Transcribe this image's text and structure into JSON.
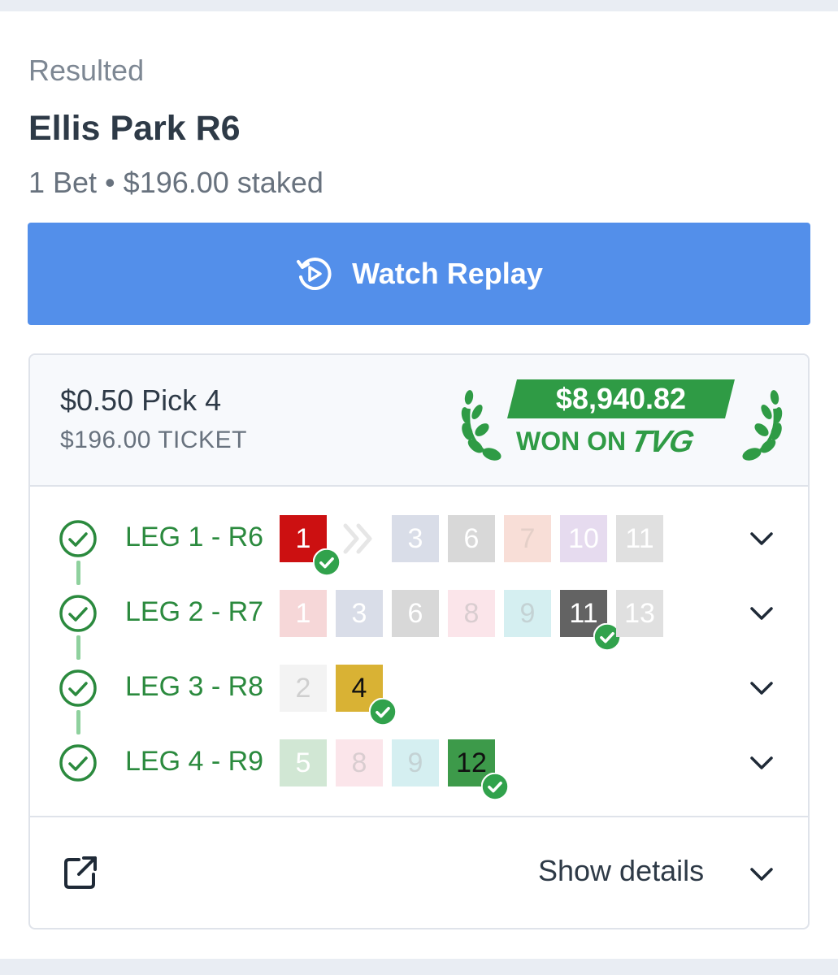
{
  "event": {
    "status": "Resulted",
    "title": "Ellis Park R6",
    "summary": "1 Bet • $196.00 staked"
  },
  "replay_button": {
    "label": "Watch Replay",
    "icon": "replay-icon"
  },
  "bet": {
    "type": "$0.50 Pick 4",
    "ticket": "$196.00 TICKET",
    "win_amount": "$8,940.82",
    "won_on": "WON ON",
    "brand": "TVG",
    "legs": [
      {
        "label": "LEG 1 - R6",
        "status": "won",
        "runners": [
          {
            "number": "1",
            "winner": true,
            "bg": "#cc1011",
            "fg": "#ffffff"
          },
          {
            "number": "3",
            "winner": false,
            "bg": "#d9dde8",
            "fg": "#ffffff"
          },
          {
            "number": "6",
            "winner": false,
            "bg": "#d8d8d8",
            "fg": "#ffffff"
          },
          {
            "number": "7",
            "winner": false,
            "bg": "#f8ded7",
            "fg": "#e4cfc8"
          },
          {
            "number": "10",
            "winner": false,
            "bg": "#e6dbef",
            "fg": "#ffffff"
          },
          {
            "number": "11",
            "winner": false,
            "bg": "#e0e0e0",
            "fg": "#ffffff"
          }
        ]
      },
      {
        "label": "LEG 2 - R7",
        "status": "won",
        "runners": [
          {
            "number": "1",
            "winner": false,
            "bg": "#f6d7d8",
            "fg": "#ffffff"
          },
          {
            "number": "3",
            "winner": false,
            "bg": "#d9dde8",
            "fg": "#ffffff"
          },
          {
            "number": "6",
            "winner": false,
            "bg": "#d8d8d8",
            "fg": "#ffffff"
          },
          {
            "number": "8",
            "winner": false,
            "bg": "#fbe5ea",
            "fg": "#d9cdd0"
          },
          {
            "number": "9",
            "winner": false,
            "bg": "#d5eff1",
            "fg": "#c4d2d4"
          },
          {
            "number": "11",
            "winner": true,
            "bg": "#636363",
            "fg": "#ffffff"
          },
          {
            "number": "13",
            "winner": false,
            "bg": "#e0e0e0",
            "fg": "#ffffff"
          }
        ]
      },
      {
        "label": "LEG 3 - R8",
        "status": "won",
        "runners": [
          {
            "number": "2",
            "winner": false,
            "bg": "#f3f3f3",
            "fg": "#cfcfcf"
          },
          {
            "number": "4",
            "winner": true,
            "bg": "#d9b234",
            "fg": "#111111"
          }
        ]
      },
      {
        "label": "LEG 4 - R9",
        "status": "won",
        "runners": [
          {
            "number": "5",
            "winner": false,
            "bg": "#d1e7d4",
            "fg": "#ffffff"
          },
          {
            "number": "8",
            "winner": false,
            "bg": "#fbe5ea",
            "fg": "#d9cdd0"
          },
          {
            "number": "9",
            "winner": false,
            "bg": "#d5eff1",
            "fg": "#c4d2d4"
          },
          {
            "number": "12",
            "winner": true,
            "bg": "#3d9a4a",
            "fg": "#111111"
          }
        ]
      }
    ]
  },
  "footer": {
    "show_details": "Show details",
    "external_icon": "external-link-icon"
  },
  "colors": {
    "primary_blue": "#538fea",
    "win_green": "#2f9b45",
    "leg_green": "#2b8a3e",
    "check_green": "#31a24c"
  }
}
